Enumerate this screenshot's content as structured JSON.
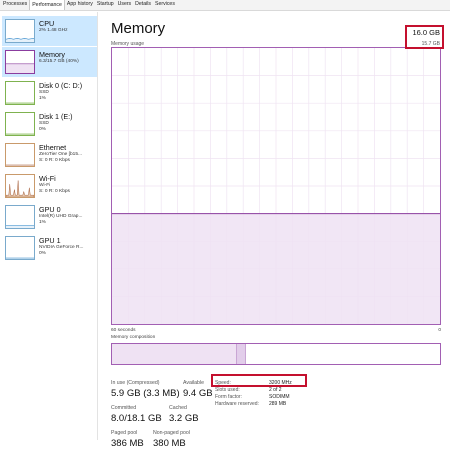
{
  "tabs": [
    "Processes",
    "Performance",
    "App history",
    "Startup",
    "Users",
    "Details",
    "Services"
  ],
  "active_tab": "Performance",
  "sidebar": {
    "items": [
      {
        "title": "CPU",
        "sub1": "2% 1.48 GHz",
        "sub2": "",
        "sub3": "",
        "icon": "cpu-graph-icon",
        "color": "#2f86c8"
      },
      {
        "title": "Memory",
        "sub1": "6.3/15.7 GB (40%)",
        "sub2": "",
        "sub3": "",
        "icon": "memory-graph-icon",
        "color": "#8b3c9e"
      },
      {
        "title": "Disk 0 (C: D:)",
        "sub1": "SSD",
        "sub2": "1%",
        "sub3": "",
        "icon": "disk-graph-icon",
        "color": "#4e9a06"
      },
      {
        "title": "Disk 1 (E:)",
        "sub1": "SSD",
        "sub2": "0%",
        "sub3": "",
        "icon": "disk-graph-icon",
        "color": "#4e9a06"
      },
      {
        "title": "Ethernet",
        "sub1": "ZeroTier One [b15...",
        "sub2": "S: 0 R: 0 Kbps",
        "sub3": "",
        "icon": "ethernet-graph-icon",
        "color": "#a0522d"
      },
      {
        "title": "Wi-Fi",
        "sub1": "Wi-Fi",
        "sub2": "S: 0 R: 0 Kbps",
        "sub3": "",
        "icon": "wifi-graph-icon",
        "color": "#a0522d"
      },
      {
        "title": "GPU 0",
        "sub1": "Intel(R) UHD Grap...",
        "sub2": "1%",
        "sub3": "",
        "icon": "gpu-graph-icon",
        "color": "#2f86c8"
      },
      {
        "title": "GPU 1",
        "sub1": "NVIDIA GeForce R...",
        "sub2": "0%",
        "sub3": "",
        "icon": "gpu-graph-icon",
        "color": "#2f86c8"
      }
    ]
  },
  "main": {
    "title": "Memory",
    "total": "16.0 GB",
    "graph_label": "Memory usage",
    "graph_max": "15.7 GB",
    "axis_left": "60 seconds",
    "axis_right": "0",
    "composition_label": "Memory composition",
    "usage_fraction": 0.4,
    "composition": [
      {
        "name": "In use",
        "fraction": 0.38,
        "color": "#efe2f3"
      },
      {
        "name": "Modified",
        "fraction": 0.03,
        "color": "#e2cdea"
      },
      {
        "name": "Standby",
        "fraction": 0.59,
        "color": "#ffffff"
      }
    ]
  },
  "stats": {
    "in_use_label": "In use (Compressed)",
    "in_use_value": "5.9 GB (3.3 MB)",
    "available_label": "Available",
    "available_value": "9.4 GB",
    "committed_label": "Committed",
    "committed_value": "8.0/18.1 GB",
    "cached_label": "Cached",
    "cached_value": "3.2 GB",
    "paged_label": "Paged pool",
    "paged_value": "386 MB",
    "nonpaged_label": "Non-paged pool",
    "nonpaged_value": "380 MB"
  },
  "specs": {
    "speed_label": "Speed:",
    "speed_value": "3200 MHz",
    "slots_label": "Slots used:",
    "slots_value": "2 of 2",
    "form_label": "Form factor:",
    "form_value": "SODIMM",
    "reserved_label": "Hardware reserved:",
    "reserved_value": "289 MB"
  },
  "colors": {
    "accent": "#8b3c9e",
    "graph_fill": "#efe2f3",
    "highlight": "#c4102e"
  }
}
